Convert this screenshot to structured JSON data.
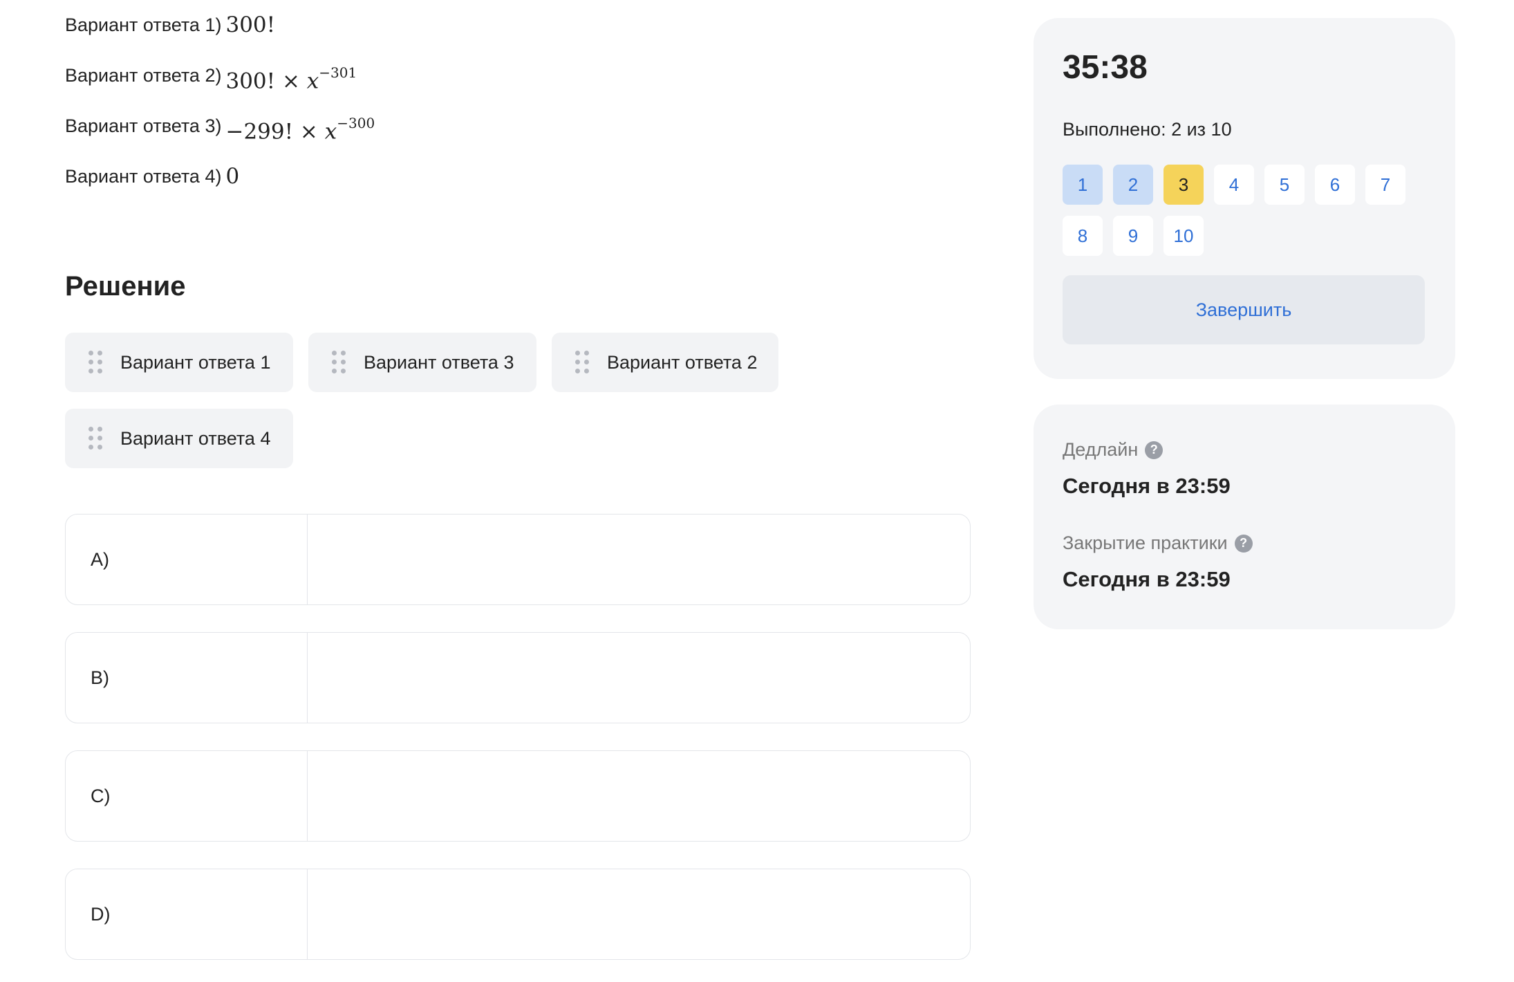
{
  "answer_options": [
    {
      "label": "Вариант ответа 1)",
      "math_main": "300!",
      "math_var": "",
      "math_sup": ""
    },
    {
      "label": "Вариант ответа 2)",
      "math_main": "300! × ",
      "math_var": "x",
      "math_sup": "−301"
    },
    {
      "label": "Вариант ответа 3)",
      "math_main": "−299! × ",
      "math_var": "x",
      "math_sup": "−300"
    },
    {
      "label": "Вариант ответа 4)",
      "math_main": "0",
      "math_var": "",
      "math_sup": ""
    }
  ],
  "solution": {
    "title": "Решение",
    "chips": [
      "Вариант ответа 1",
      "Вариант ответа 3",
      "Вариант ответа 2",
      "Вариант ответа 4"
    ],
    "rows": [
      "A)",
      "B)",
      "C)",
      "D)"
    ]
  },
  "sidebar": {
    "timer": "35:38",
    "progress": "Выполнено: 2 из 10",
    "questions": [
      "1",
      "2",
      "3",
      "4",
      "5",
      "6",
      "7",
      "8",
      "9",
      "10"
    ],
    "question_states": [
      "done",
      "done",
      "current",
      "todo",
      "todo",
      "todo",
      "todo",
      "todo",
      "todo",
      "todo"
    ],
    "finish_label": "Завершить",
    "deadline_label": "Дедлайн",
    "deadline_value": "Сегодня в 23:59",
    "closing_label": "Закрытие практики",
    "closing_value": "Сегодня в 23:59",
    "help_icon": "?"
  },
  "colors": {
    "accent": "#2f6fd6",
    "current_question": "#f5d35a",
    "done_question": "#c9dcf6",
    "panel_bg": "#f4f5f7"
  }
}
